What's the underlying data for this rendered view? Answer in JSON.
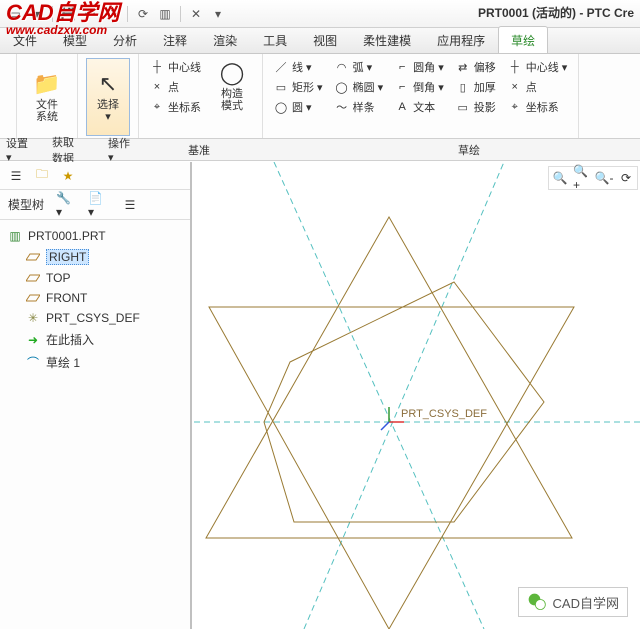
{
  "watermark": {
    "line1": "CAD自学网",
    "line2": "www.cadzxw.com"
  },
  "titlebar": {
    "title": "PRT0001 (活动的) - PTC Cre"
  },
  "menu": {
    "items": [
      "文件",
      "模型",
      "分析",
      "注释",
      "渲染",
      "工具",
      "视图",
      "柔性建模",
      "应用程序",
      "草绘"
    ],
    "active": 9
  },
  "ribbon": {
    "groups": [
      {
        "label": "设置 ▾",
        "big": []
      },
      {
        "label": "获取数据",
        "big": [
          {
            "icon": "📁",
            "text": "文件\n系统"
          }
        ]
      },
      {
        "label": "操作 ▾",
        "big": [
          {
            "icon": "↖",
            "text": "选择\n▾",
            "sel": true
          }
        ]
      },
      {
        "label": "基准",
        "cols": [
          [
            {
              "ic": "┼",
              "t": "中心线"
            },
            {
              "ic": "×",
              "t": "点"
            },
            {
              "ic": "⌖",
              "t": "坐标系"
            }
          ],
          [
            {
              "ic": "◯",
              "big": true,
              "t": "构造\n模式"
            }
          ]
        ]
      },
      {
        "label": "草绘",
        "cols": [
          [
            {
              "ic": "／",
              "t": "线 ▾"
            },
            {
              "ic": "▭",
              "t": "矩形 ▾"
            },
            {
              "ic": "◯",
              "t": "圆 ▾"
            }
          ],
          [
            {
              "ic": "◠",
              "t": "弧 ▾"
            },
            {
              "ic": "◯",
              "t": "椭圆 ▾"
            },
            {
              "ic": "～",
              "t": "样条"
            }
          ],
          [
            {
              "ic": "⌐",
              "t": "圆角 ▾"
            },
            {
              "ic": "⌐",
              "t": "倒角 ▾"
            },
            {
              "ic": "A",
              "t": "文本"
            }
          ],
          [
            {
              "ic": "⇄",
              "t": "偏移"
            },
            {
              "ic": "▯",
              "t": "加厚"
            },
            {
              "ic": "▭",
              "t": "投影"
            }
          ],
          [
            {
              "ic": "┼",
              "t": "中心线 ▾"
            },
            {
              "ic": "×",
              "t": "点"
            },
            {
              "ic": "⌖",
              "t": "坐标系"
            }
          ]
        ]
      }
    ]
  },
  "treebar": {
    "label": "模型树",
    "tools": [
      "🔧",
      "📄",
      "☰"
    ]
  },
  "tree": {
    "root": "PRT0001.PRT",
    "children": [
      {
        "ic": "plane",
        "t": "RIGHT",
        "sel": true
      },
      {
        "ic": "plane",
        "t": "TOP"
      },
      {
        "ic": "plane",
        "t": "FRONT"
      },
      {
        "ic": "csys",
        "t": "PRT_CSYS_DEF"
      },
      {
        "ic": "insert",
        "t": "在此插入"
      },
      {
        "ic": "sketch",
        "t": "草绘 1"
      }
    ]
  },
  "canvas": {
    "csys_label": "PRT_CSYS_DEF",
    "view_tools": [
      "🔍",
      "🔍+",
      "🔍-",
      "⟳"
    ]
  },
  "wechat": {
    "name": "CAD自学网"
  }
}
